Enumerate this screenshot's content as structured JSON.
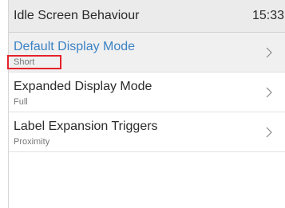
{
  "header": {
    "title": "Idle Screen Behaviour",
    "clock": "15:33"
  },
  "menu": {
    "items": [
      {
        "label": "Default Display Mode",
        "value": "Short",
        "selected": true,
        "icon": "chevron-right-icon"
      },
      {
        "label": "Expanded Display Mode",
        "value": "Full",
        "selected": false,
        "icon": "chevron-right-icon"
      },
      {
        "label": "Label Expansion Triggers",
        "value": "Proximity",
        "selected": false,
        "icon": "chevron-right-icon"
      }
    ]
  },
  "colors": {
    "selected_text": "#3c82c4",
    "selected_background": "#f0f0f0",
    "header_background": "#ebebeb",
    "annotation_outline": "#e5222a"
  }
}
